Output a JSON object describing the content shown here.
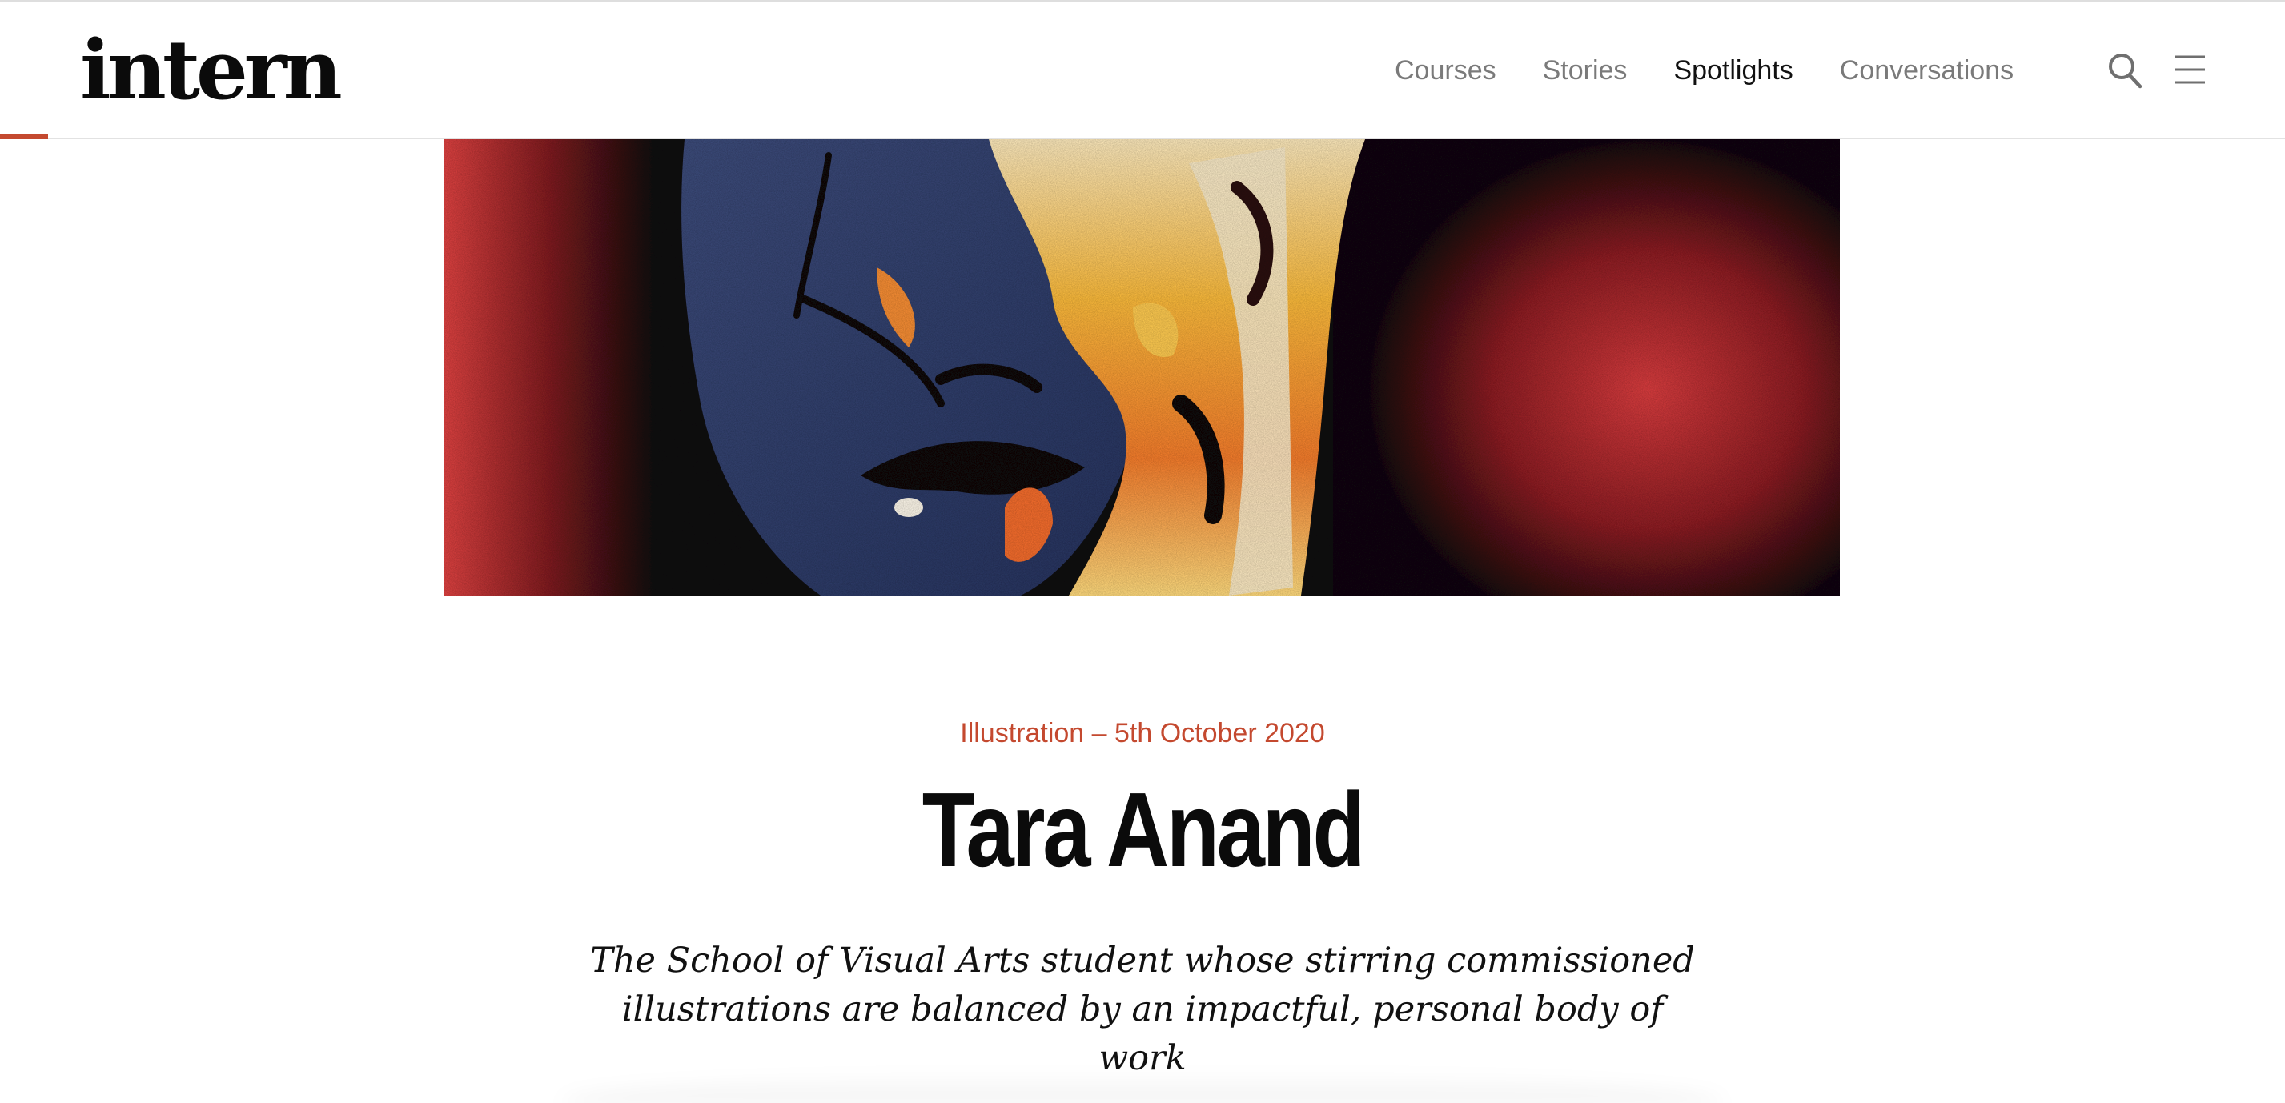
{
  "header": {
    "logo": "intern",
    "nav": {
      "courses": "Courses",
      "stories": "Stories",
      "spotlights": "Spotlights",
      "conversations": "Conversations"
    },
    "active_nav": "Spotlights",
    "accent_color": "#c4492f",
    "icons": [
      "search-icon",
      "menu-icon"
    ]
  },
  "hero": {
    "image_description_icon": "hero-illustration"
  },
  "article": {
    "meta": "Illustration – 5th October 2020",
    "title": "Tara Anand",
    "standfirst_line1": "The School of Visual Arts student whose stirring commissioned",
    "standfirst_line2": "illustrations are balanced by an impactful, personal body of work"
  }
}
